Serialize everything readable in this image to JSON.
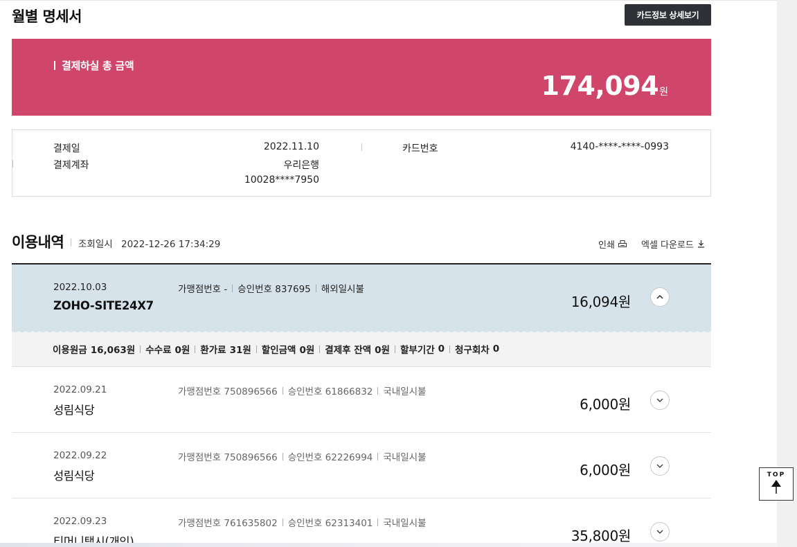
{
  "header": {
    "title": "월별 명세서",
    "card_info_button": "카드정보 상세보기"
  },
  "total": {
    "label": "결제하실 총 금액",
    "amount": "174,094",
    "unit": "원"
  },
  "payment_info": {
    "payment_date_label": "결제일",
    "payment_date": "2022.11.10",
    "account_label": "결제계좌",
    "bank": "우리은행",
    "account_number": "10028****7950",
    "card_number_label": "카드번호",
    "card_number": "4140-****-****-0993"
  },
  "usage": {
    "title": "이용내역",
    "query_label": "조회일시",
    "query_datetime": "2022-12-26 17:34:29",
    "print_label": "인쇄",
    "excel_label": "엑셀 다운로드"
  },
  "transactions": [
    {
      "date": "2022.10.03",
      "merchant_no": "가맹점번호 -",
      "approval": "승인번호 837695",
      "type": "해외일시불",
      "merchant": "ZOHO-SITE24X7",
      "amount": "16,094원",
      "expanded": true
    },
    {
      "date": "2022.09.21",
      "merchant_no": "가맹점번호 750896566",
      "approval": "승인번호 61866832",
      "type": "국내일시불",
      "merchant": "성림식당",
      "amount": "6,000원",
      "expanded": false
    },
    {
      "date": "2022.09.22",
      "merchant_no": "가맹점번호 750896566",
      "approval": "승인번호 62226994",
      "type": "국내일시불",
      "merchant": "성림식당",
      "amount": "6,000원",
      "expanded": false
    },
    {
      "date": "2022.09.23",
      "merchant_no": "가맹점번호 761635802",
      "approval": "승인번호 62313401",
      "type": "국내일시불",
      "merchant": "티머니택시(개인)",
      "amount": "35,800원",
      "expanded": false
    }
  ],
  "detail": {
    "principal_label": "이용원금",
    "principal": "16,063원",
    "fee_label": "수수료",
    "fee": "0원",
    "fx_fee_label": "환가료",
    "fx_fee": "31원",
    "discount_label": "할인금액",
    "discount": "0원",
    "balance_label": "결제후 잔액",
    "balance": "0원",
    "installment_label": "할부기간",
    "installment": "0",
    "billing_count_label": "청구회차",
    "billing_count": "0"
  },
  "top_button": "TOP",
  "colors": {
    "accent_pink": "#d0456a",
    "expanded_bg": "#d7e3ea",
    "dark_button": "#2e3136"
  }
}
